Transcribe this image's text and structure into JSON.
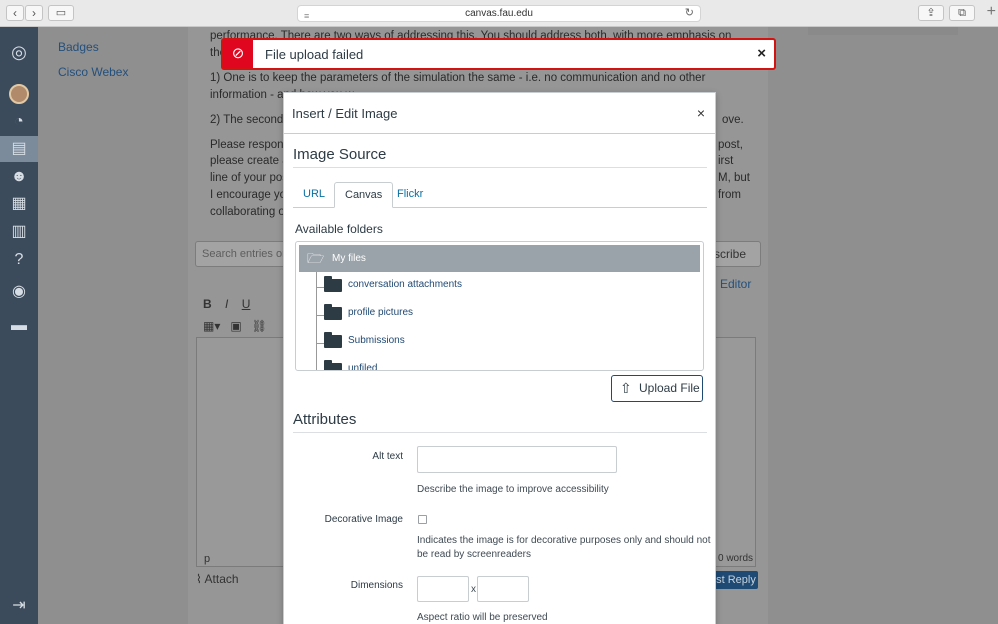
{
  "browser": {
    "url": "canvas.fau.edu",
    "back_glyph": "‹",
    "forward_glyph": "›"
  },
  "global_nav": {
    "items": [
      "logo-icon",
      "account-avatar",
      "dashboard-icon",
      "courses-icon",
      "groups-icon",
      "calendar-icon",
      "inbox-icon",
      "help-icon",
      "studio-icon",
      "files-icon",
      "collapse-icon"
    ]
  },
  "course_nav": {
    "items": [
      {
        "label": "Badges"
      },
      {
        "label": "Cisco Webex"
      }
    ]
  },
  "discussion": {
    "para1": "performance. There are two ways of addressing this. You should address both, with more emphasis on the fir",
    "para2": "1) One is to keep the parameters of the simulation the same - i.e. no communication and no other information - and how you w",
    "para3": "2) The second i",
    "para3_end": "ove.",
    "para4_lines": [
      "Please respond",
      "please create a",
      "line of your pos",
      "I encourage you",
      "collaborating o"
    ],
    "para4_tails": [
      "post,",
      "irst",
      "M, but",
      "from"
    ],
    "search_placeholder": "Search entries or a",
    "subscribe_label": "scribe",
    "rce_link": "Editor",
    "p_tag": "p",
    "word_count": "0 words",
    "attach_label": "Attach",
    "reply_label": "st Reply"
  },
  "flash": {
    "message": "File upload failed",
    "close": "×"
  },
  "modal": {
    "title": "Insert / Edit Image",
    "close": "×",
    "image_source_heading": "Image Source",
    "tabs": [
      {
        "label": "URL",
        "active": false
      },
      {
        "label": "Canvas",
        "active": true
      },
      {
        "label": "Flickr",
        "active": false
      }
    ],
    "available_folders_label": "Available folders",
    "tree": {
      "root": "My files",
      "children": [
        "conversation attachments",
        "profile pictures",
        "Submissions",
        "unfiled"
      ]
    },
    "upload_button": "Upload File",
    "attributes_heading": "Attributes",
    "alt_text_label": "Alt text",
    "alt_text_value": "",
    "alt_text_hint": "Describe the image to improve accessibility",
    "decorative_label": "Decorative Image",
    "decorative_checked": false,
    "decorative_hint_1": "Indicates the image is for decorative purposes only and should not",
    "decorative_hint_2": "be read by screenreaders",
    "dimensions_label": "Dimensions",
    "width_value": "",
    "height_value": "",
    "dimension_separator": "x",
    "aspect_hint": "Aspect ratio will be preserved"
  },
  "colors": {
    "error": "#e0061f",
    "link": "#0770a3",
    "nav_bg": "#3c4b5c"
  }
}
